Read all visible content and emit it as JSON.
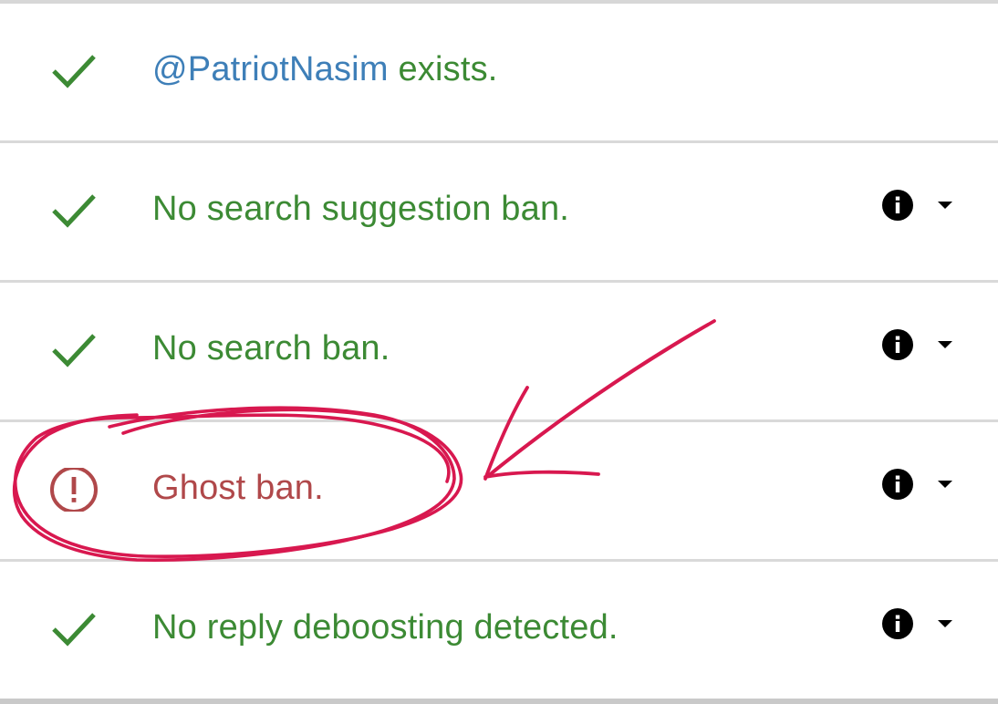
{
  "results": [
    {
      "status": "ok",
      "icon": "check-icon",
      "handle": "@PatriotNasim",
      "label": " exists.",
      "has_details": false
    },
    {
      "status": "ok",
      "icon": "check-icon",
      "label": "No search suggestion ban.",
      "has_details": true
    },
    {
      "status": "ok",
      "icon": "check-icon",
      "label": "No search ban.",
      "has_details": true
    },
    {
      "status": "fail",
      "icon": "alert-circle-icon",
      "label": "Ghost ban.",
      "has_details": true
    },
    {
      "status": "ok",
      "icon": "check-icon",
      "label": "No reply deboosting detected.",
      "has_details": true
    }
  ],
  "controls": {
    "info_icon": "info-icon",
    "expand_icon": "caret-down-icon"
  },
  "colors": {
    "ok": "#3c8a34",
    "fail": "#b0484a",
    "handle": "#3e7fb8",
    "annotation": "#d8184f",
    "divider": "#d9d9d9"
  },
  "annotation": {
    "type": "hand-drawn circle and arrow",
    "highlights": "Ghost ban."
  }
}
